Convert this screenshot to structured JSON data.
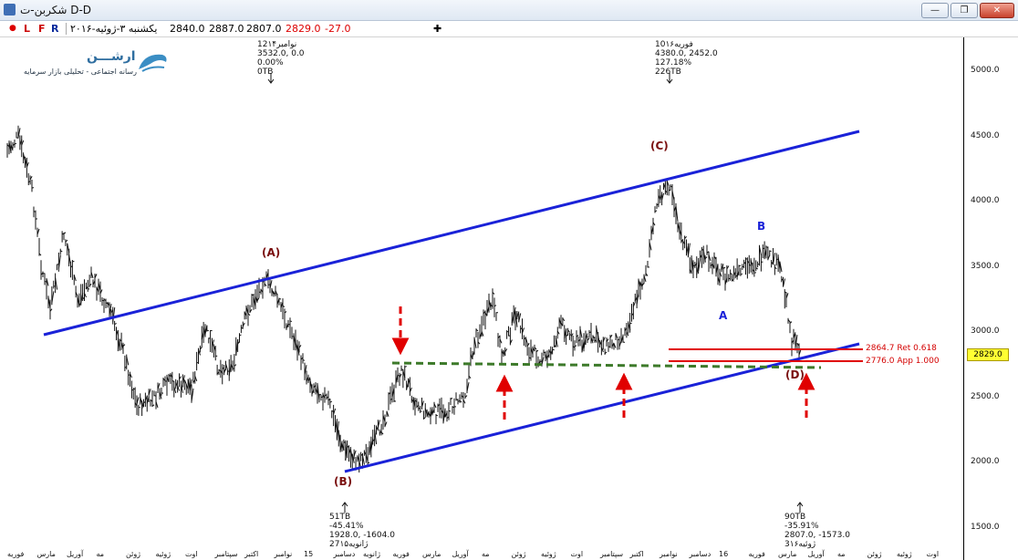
{
  "window": {
    "title": "شکربن-ت  D-D",
    "min": "—",
    "restore": "❐",
    "close": "✕"
  },
  "toolbar": {
    "flags": [
      "L",
      "F",
      "R"
    ],
    "date": "یکشنبه ۳-ژوئیه-۲۰۱۶",
    "open": "2840.0",
    "high": "2887.0",
    "low": "2807.0",
    "close": "2829.0",
    "change": "-27.0",
    "add": "✚"
  },
  "logo": {
    "name": "ارشـــن",
    "tagline": "رسانه اجتماعی - تحلیلی بازار سرمایه"
  },
  "price_axis": {
    "ticks": [
      "5000.0",
      "4500.0",
      "4000.0",
      "3500.0",
      "3000.0",
      "2500.0",
      "2000.0",
      "1500.0"
    ],
    "current": "2829.0"
  },
  "waves": {
    "A_big": "(A)",
    "B_big": "(B)",
    "C_big": "(C)",
    "D_big": "(D)",
    "A_small": "A",
    "B_small": "B"
  },
  "levels": {
    "ret": "2864.7 Ret 0.618",
    "app": "2776.0 App 1.000"
  },
  "annotations": {
    "top1": "12نوامبر۱۴\n3532.0, 0.0\n0.00%\n0TB",
    "top2": "10فوریه۱۶\n4380.0, 2452.0\n127.18%\n226TB",
    "bot1": "51TB\n-45.41%\n1928.0, -1604.0\n27ژانویه۱۵",
    "bot2": "90TB\n-35.91%\n2807.0, -1573.0\n3ژوئیه۱۶"
  },
  "x_axis": [
    "فوریه",
    "مارس",
    "آوریل",
    "مه",
    "ژوئن",
    "ژوئیه",
    "اوت",
    "سپتامبر",
    "اکتبر",
    "نوامبر",
    "15",
    "دسامبر",
    "ژانویه",
    "فوریه",
    "مارس",
    "آوریل",
    "مه",
    "ژوئن",
    "ژوئیه",
    "اوت",
    "سپتامبر",
    "اکتبر",
    "نوامبر",
    "دسامبر",
    "16",
    "فوریه",
    "مارس",
    "آوریل",
    "مه",
    "ژوئن",
    "ژوئیه",
    "اوت"
  ],
  "colors": {
    "channel": "#1a22d8",
    "level": "#e00000",
    "support": "#3d7a2a",
    "arrow": "#e00000",
    "wave_big": "#7a1010",
    "wave_small": "#1a22d8"
  }
}
